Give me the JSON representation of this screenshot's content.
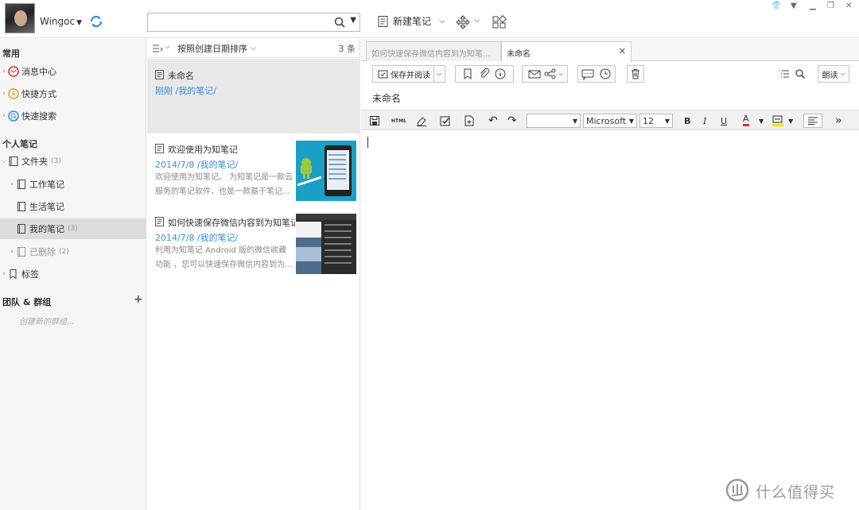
{
  "user": {
    "name": "Wingoc"
  },
  "toolbar": {
    "new_note": "新建笔记"
  },
  "sidebar": {
    "common_section": "常用",
    "common_items": [
      {
        "label": "消息中心"
      },
      {
        "label": "快捷方式"
      },
      {
        "label": "快速搜索"
      }
    ],
    "personal_section": "个人笔记",
    "folder": {
      "label": "文件夹",
      "count": "(3)"
    },
    "subfolders": [
      {
        "label": "工作笔记",
        "count": ""
      },
      {
        "label": "生活笔记",
        "count": ""
      },
      {
        "label": "我的笔记",
        "count": "(3)"
      }
    ],
    "deleted": {
      "label": "已删除",
      "count": "(2)"
    },
    "tags": {
      "label": "标签"
    },
    "team_section": "团队 & 群组",
    "team_hint": "创建新的群组..."
  },
  "note_list": {
    "sort_label": "按照创建日期排序",
    "count": "3 条",
    "notes": [
      {
        "title": "未命名",
        "date": "刚刚",
        "path": "/我的笔记/",
        "snippet1": "",
        "snippet2": ""
      },
      {
        "title": "欢迎使用为知笔记",
        "date": "2014/7/8",
        "path": "/我的笔记/",
        "snippet1": "欢迎使用为知笔记。 为知笔记是一款云",
        "snippet2": "服务的笔记软件，也是一款基于笔记..."
      },
      {
        "title": "如何快速保存微信内容到为知笔记...",
        "date": "2014/7/8",
        "path": "/我的笔记/",
        "snippet1": "利用为知笔记 Android 版的微信收藏",
        "snippet2": "功能 ，您可以快速保存微信内容到为..."
      }
    ]
  },
  "editor": {
    "tabs": [
      {
        "label": "如何快速保存微信内容到为知笔..."
      },
      {
        "label": "未命名"
      }
    ],
    "save_read": "保存并阅读",
    "read_aloud": "朗读",
    "note_title": "未命名",
    "html_label": "HTML",
    "font_name": "Microsoft",
    "font_size": "12",
    "bold": "B",
    "italic": "I",
    "underline": "U",
    "font_color": "A"
  },
  "watermark": {
    "text": "什么值得买"
  },
  "colors": {
    "link": "#3b8fd6",
    "accent_red": "#d9302c",
    "highlight_yellow": "#f5e000"
  }
}
